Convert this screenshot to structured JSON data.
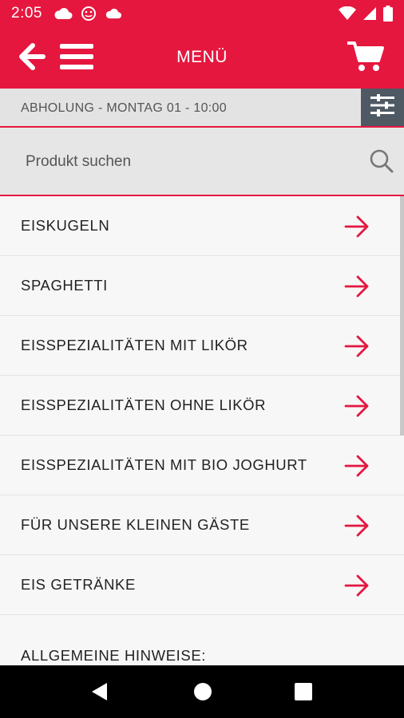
{
  "status": {
    "time": "2:05",
    "left_icons": [
      "cloud-icon",
      "face-icon",
      "cloud-icon"
    ],
    "right_icons": [
      "wifi-icon",
      "signal-icon",
      "battery-icon"
    ]
  },
  "appbar": {
    "title": "MENÜ",
    "brand_color": "#e5173f"
  },
  "pickup": {
    "text": "ABHOLUNG - MONTAG 01 - 10:00"
  },
  "search": {
    "placeholder": "Produkt suchen",
    "value": ""
  },
  "categories": [
    {
      "label": "EISKUGELN"
    },
    {
      "label": "SPAGHETTI"
    },
    {
      "label": "EISSPEZIALITÄTEN MIT LIKÖR"
    },
    {
      "label": "EISSPEZIALITÄTEN OHNE LIKÖR"
    },
    {
      "label": "EISSPEZIALITÄTEN MIT BIO JOGHURT"
    },
    {
      "label": "FÜR UNSERE KLEINEN GÄSTE"
    },
    {
      "label": "EIS GETRÄNKE"
    }
  ],
  "notes": {
    "heading": "ALLGEMEINE HINWEISE:"
  }
}
